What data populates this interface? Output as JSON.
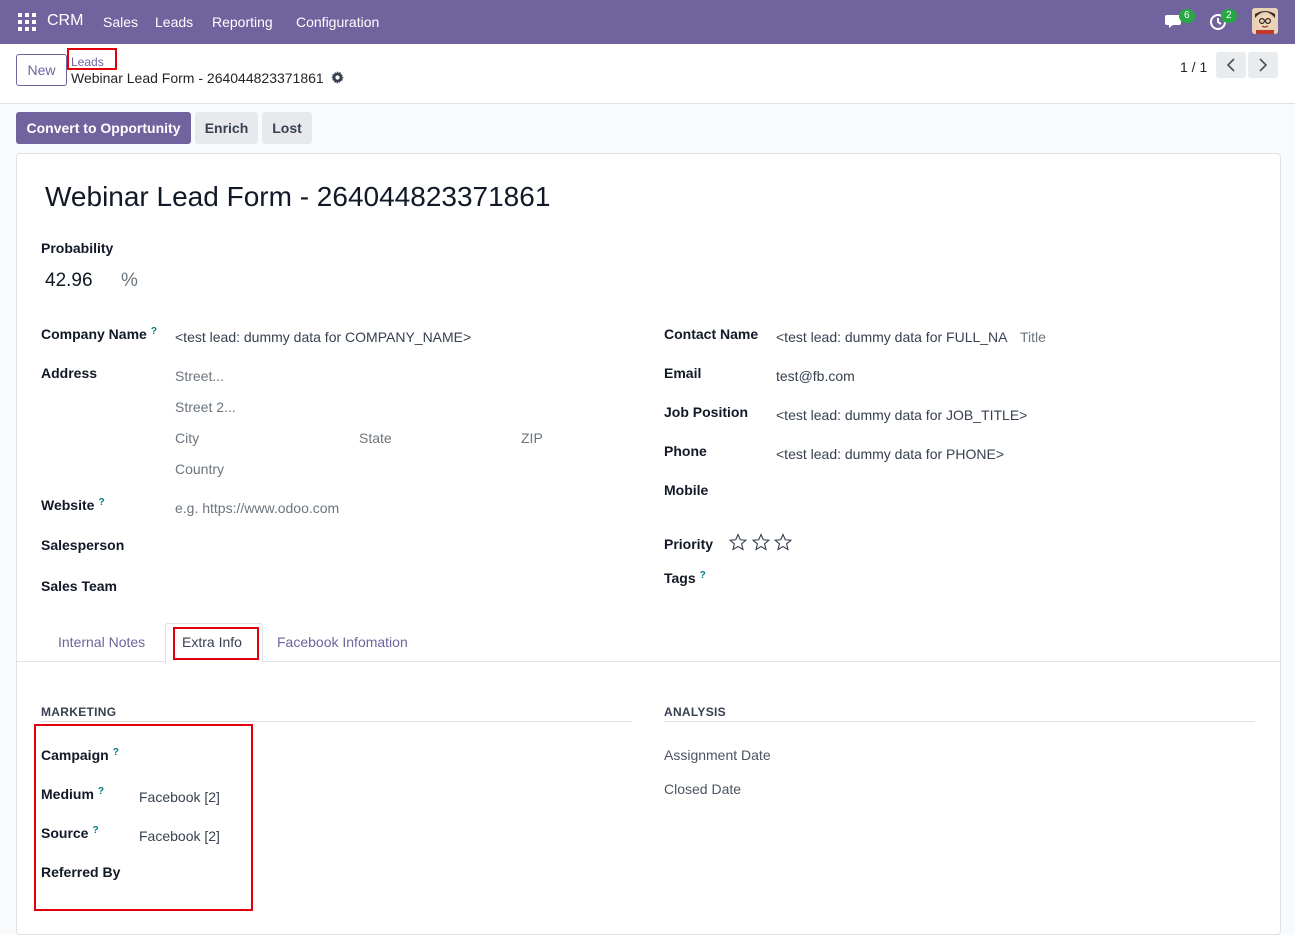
{
  "topbar": {
    "brand": "CRM",
    "menu": [
      "Sales",
      "Leads",
      "Reporting",
      "Configuration"
    ],
    "messages_count": "6",
    "activities_count": "2"
  },
  "control": {
    "new_label": "New",
    "breadcrumb_parent": "Leads",
    "breadcrumb_current": "Webinar Lead Form - 264044823371861",
    "pager": "1 / 1"
  },
  "actions": {
    "convert": "Convert to Opportunity",
    "enrich": "Enrich",
    "lost": "Lost"
  },
  "form": {
    "title": "Webinar Lead Form - 264044823371861",
    "probability_label": "Probability",
    "probability_value": "42.96",
    "probability_unit": "%",
    "left": {
      "company_label": "Company Name",
      "company_value": "<test lead: dummy data for COMPANY_NAME>",
      "address_label": "Address",
      "street_ph": "Street...",
      "street2_ph": "Street 2...",
      "city_ph": "City",
      "state_ph": "State",
      "zip_ph": "ZIP",
      "country_ph": "Country",
      "website_label": "Website",
      "website_ph": "e.g. https://www.odoo.com",
      "salesperson_label": "Salesperson",
      "salesteam_label": "Sales Team"
    },
    "right": {
      "contact_label": "Contact Name",
      "contact_value": "<test lead: dummy data for FULL_NA",
      "title_ph": "Title",
      "email_label": "Email",
      "email_value": "test@fb.com",
      "job_label": "Job Position",
      "job_value": "<test lead: dummy data for JOB_TITLE>",
      "phone_label": "Phone",
      "phone_value": "<test lead: dummy data for PHONE>",
      "mobile_label": "Mobile",
      "priority_label": "Priority",
      "priority_value": 0,
      "priority_max": 3,
      "tags_label": "Tags"
    },
    "help_mark": "?"
  },
  "tabs": {
    "internal_notes": "Internal Notes",
    "extra_info": "Extra Info",
    "facebook": "Facebook Infomation"
  },
  "extra": {
    "marketing_title": "MARKETING",
    "campaign_label": "Campaign",
    "medium_label": "Medium",
    "medium_value": "Facebook [2]",
    "source_label": "Source",
    "source_value": "Facebook [2]",
    "referred_label": "Referred By",
    "analysis_title": "ANALYSIS",
    "assignment_label": "Assignment Date",
    "closed_label": "Closed Date"
  },
  "colors": {
    "brand": "#71639e",
    "highlight": "#e4000b",
    "badge": "#28a745",
    "help": "#017e84"
  }
}
